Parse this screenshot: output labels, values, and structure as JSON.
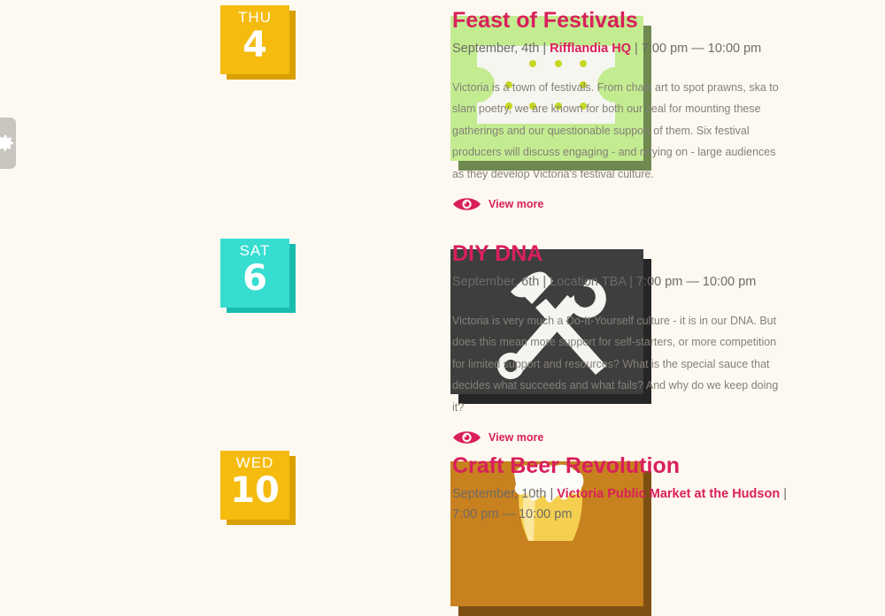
{
  "events": [
    {
      "day": "THU",
      "num": "4",
      "title": "Feast of Festivals",
      "date": "September, 4th",
      "sep1": " | ",
      "venue": "Rifflandia HQ",
      "sep2": " | ",
      "time": "7:00 pm — 10:00 pm",
      "description": "Victoria is a town of festivals. From chalk art to spot prawns, ska to slam poetry, we are known for both our zeal for mounting these gatherings and our questionable support of them. Six festival producers will discuss engaging - and relying on - large audiences as they develop Victoria's festival culture.",
      "view_more": "View more",
      "icon": "ticket-icon",
      "colors": {
        "card": "#c3ec91",
        "card_side": "#6f8a4f",
        "date": "#f5bb0f",
        "date_side": "#d9a000"
      }
    },
    {
      "day": "SAT",
      "num": "6",
      "title": "DIY DNA",
      "meta": "September, 6th | Location TBA | 7:00 pm — 10:00 pm",
      "description": "Victoria is very much a Do-It-Yourself culture - it is in our DNA. But does this mean more support for self-starters, or more competition for limited support and resources? What is the special sauce that decides what succeeds and what fails? And why do we keep doing it?",
      "view_more": "View more",
      "icon": "hammer-wrench-icon",
      "colors": {
        "card": "#3e3e3e",
        "card_side": "#262626",
        "date": "#37ddd0",
        "date_side": "#1bbcb0"
      }
    },
    {
      "day": "WED",
      "num": "10",
      "title": "Craft Beer Revolution",
      "date": "September, 10th",
      "sep1": " | ",
      "venue": "Victoria Public Market at the Hudson",
      "sep2": " |",
      "time": "7:00 pm — 10:00 pm",
      "icon": "beer-glass-icon",
      "colors": {
        "card": "#c8811f",
        "card_side": "#7e4f12",
        "date": "#f5bb0f",
        "date_side": "#d9a000"
      }
    }
  ],
  "side_tab_icon": "gear-icon"
}
